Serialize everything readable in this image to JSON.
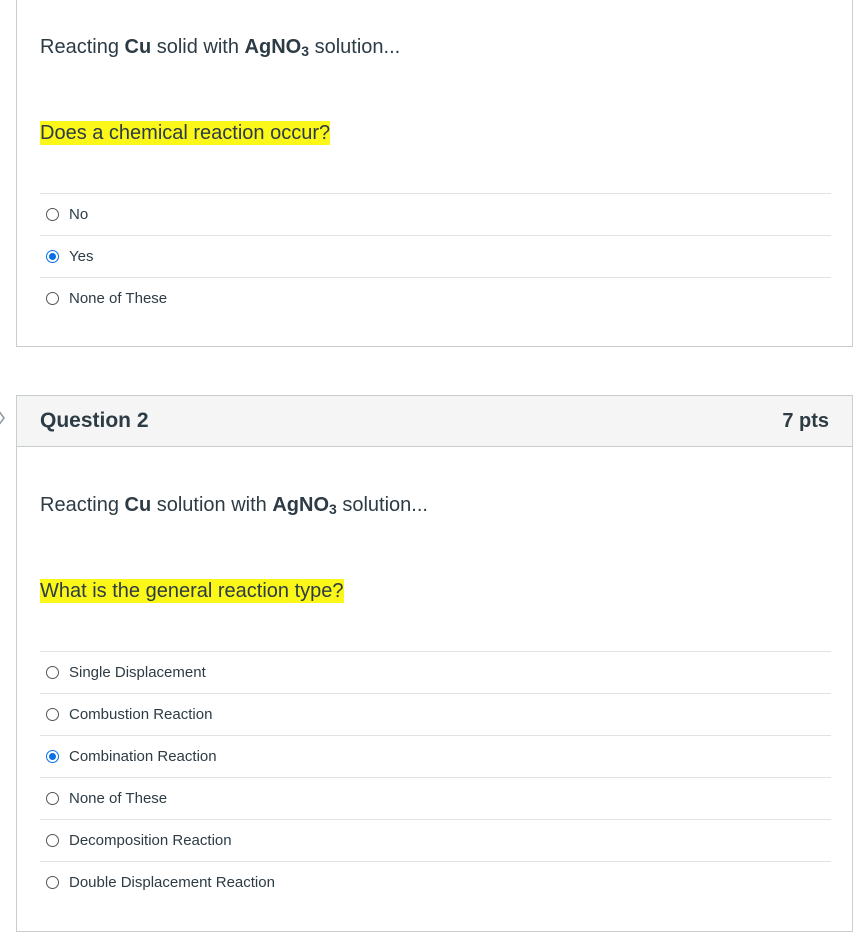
{
  "question1": {
    "stem_prefix": "Reacting ",
    "stem_bold1": "Cu",
    "stem_middle": " solid with ",
    "stem_bold2": "AgNO",
    "stem_sub": "3",
    "stem_suffix": " solution...",
    "prompt": "Does a chemical reaction occur?",
    "answers": [
      {
        "label": "No",
        "selected": false
      },
      {
        "label": "Yes",
        "selected": true
      },
      {
        "label": "None of These",
        "selected": false
      }
    ]
  },
  "question2": {
    "title": "Question 2",
    "points": "7 pts",
    "stem_prefix": "Reacting ",
    "stem_bold1": "Cu",
    "stem_middle": " solution with ",
    "stem_bold2": "AgNO",
    "stem_sub": "3",
    "stem_suffix": " solution...",
    "prompt": "What is the general reaction type?",
    "answers": [
      {
        "label": "Single Displacement",
        "selected": false
      },
      {
        "label": "Combustion Reaction",
        "selected": false
      },
      {
        "label": "Combination Reaction",
        "selected": true
      },
      {
        "label": "None of These",
        "selected": false
      },
      {
        "label": "Decomposition Reaction",
        "selected": false
      },
      {
        "label": "Double Displacement Reaction",
        "selected": false
      }
    ]
  },
  "colors": {
    "highlight": "#fbf719",
    "selected_radio": "#0770e3",
    "text": "#2d3b45",
    "header_bg": "#f5f5f5"
  }
}
